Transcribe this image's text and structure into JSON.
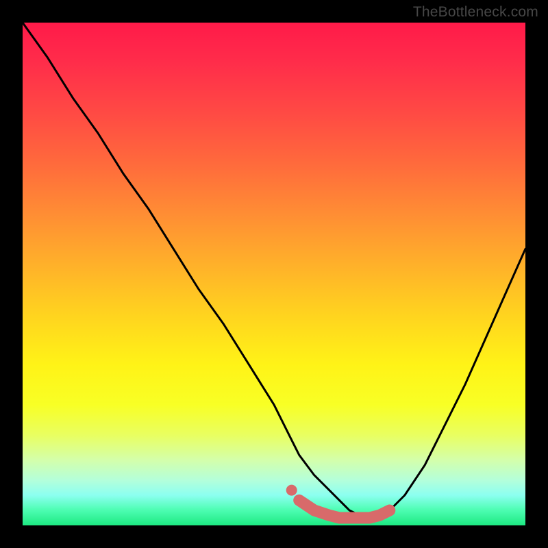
{
  "watermark": "TheBottleneck.com",
  "chart_data": {
    "type": "line",
    "title": "",
    "xlabel": "",
    "ylabel": "",
    "xlim": [
      0,
      100
    ],
    "ylim": [
      0,
      100
    ],
    "grid": false,
    "series": [
      {
        "name": "main-curve",
        "color": "#000000",
        "x": [
          0,
          5,
          10,
          15,
          20,
          25,
          30,
          35,
          40,
          45,
          50,
          53,
          55,
          58,
          61,
          63,
          65,
          67,
          69,
          71,
          73,
          76,
          80,
          84,
          88,
          92,
          96,
          100
        ],
        "y": [
          100,
          93,
          85,
          78,
          70,
          63,
          55,
          47,
          40,
          32,
          24,
          18,
          14,
          10,
          7,
          5,
          3,
          2,
          2,
          2,
          3,
          6,
          12,
          20,
          28,
          37,
          46,
          55
        ]
      },
      {
        "name": "highlight-band",
        "color": "#d86a6a",
        "x": [
          55,
          58,
          61,
          63,
          65,
          67,
          69,
          71,
          73
        ],
        "y": [
          5,
          3,
          2,
          1.5,
          1.5,
          1.5,
          1.5,
          2,
          3
        ]
      },
      {
        "name": "highlight-dot",
        "color": "#d86a6a",
        "x": [
          53.5
        ],
        "y": [
          7
        ]
      }
    ]
  }
}
